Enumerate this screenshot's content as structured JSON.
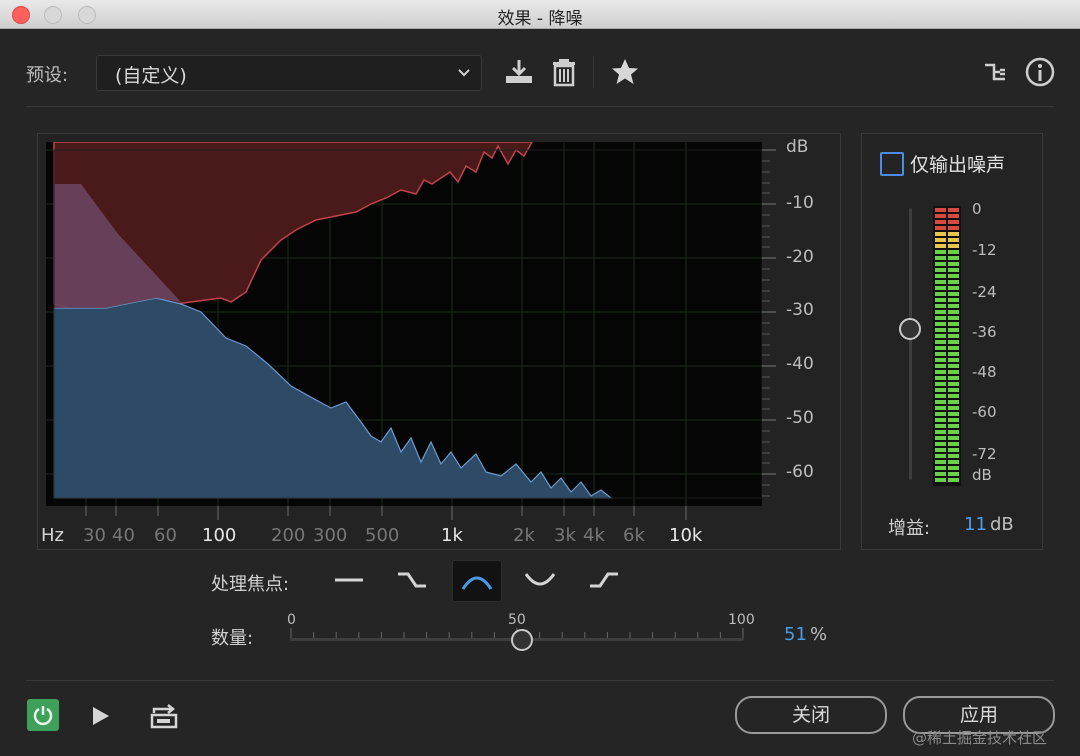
{
  "window": {
    "title": "效果 - 降噪"
  },
  "preset": {
    "label": "预设:",
    "value": "(自定义)"
  },
  "toolbar": {
    "icons": [
      "download-icon",
      "trash-icon",
      "star-icon",
      "routing-icon",
      "info-icon"
    ]
  },
  "graph": {
    "db_axis_label": "dB",
    "db_ticks": [
      "-10",
      "-20",
      "-30",
      "-40",
      "-50",
      "-60"
    ],
    "freq_axis_label": "Hz",
    "freq_ticks": [
      {
        "t": "30",
        "major": false
      },
      {
        "t": "40",
        "major": false
      },
      {
        "t": "60",
        "major": false
      },
      {
        "t": "100",
        "major": true
      },
      {
        "t": "200",
        "major": false
      },
      {
        "t": "300",
        "major": false
      },
      {
        "t": "500",
        "major": false
      },
      {
        "t": "1k",
        "major": true
      },
      {
        "t": "2k",
        "major": false
      },
      {
        "t": "3k",
        "major": false
      },
      {
        "t": "4k",
        "major": false
      },
      {
        "t": "6k",
        "major": false
      },
      {
        "t": "10k",
        "major": true
      }
    ]
  },
  "output_noise_only": {
    "label": "仅输出噪声",
    "checked": false
  },
  "meter": {
    "ticks": [
      "0",
      "-12",
      "-24",
      "-36",
      "-48",
      "-60",
      "-72"
    ],
    "unit": "dB"
  },
  "gain": {
    "label": "增益:",
    "value": "11",
    "unit": "dB"
  },
  "focus": {
    "label": "处理焦点:",
    "options": [
      "flat-icon",
      "low-shelf-icon",
      "mid-boost-icon",
      "mid-cut-icon",
      "high-shelf-icon"
    ],
    "selected": 2
  },
  "amount": {
    "label": "数量:",
    "scale": [
      "0",
      "50",
      "100"
    ],
    "value": "51",
    "unit": "%",
    "fraction": 0.51
  },
  "footer": {
    "close_label": "关闭",
    "apply_label": "应用"
  },
  "watermark": "@稀土掘金技术社区",
  "colors": {
    "accent": "#4c9be8",
    "noise_fill": "#5b1f1f",
    "signal_fill": "#33506e",
    "power_on": "#3fa05a"
  }
}
